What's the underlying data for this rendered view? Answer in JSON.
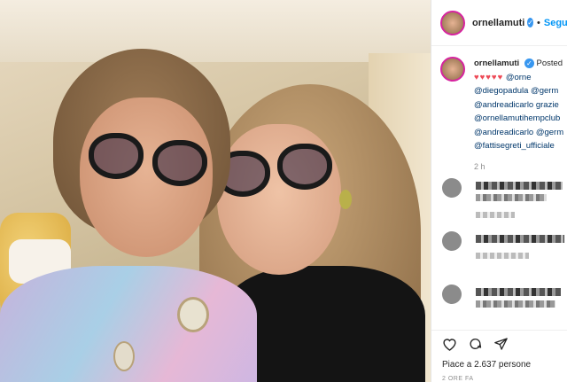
{
  "header": {
    "username": "ornellamuti",
    "separator": "•",
    "follow_label": "Segui"
  },
  "caption": {
    "username": "ornellamuti",
    "posted_label": "Posted",
    "hearts": "♥♥♥♥♥",
    "lines": [
      "@orne",
      "@diegopadula @germ",
      "@andreadicarlo grazie",
      "@ornellamutihempclub",
      "@andreadicarlo @germ",
      "@fattisegreti_ufficiale"
    ],
    "time": "2 h"
  },
  "actions": {
    "like_icon": "heart-icon",
    "comment_icon": "comment-icon",
    "share_icon": "send-icon"
  },
  "likes_text": "Piace a 2.637 persone",
  "ago_text": "2 ORE FA",
  "colors": {
    "follow": "#0095f6",
    "verified": "#3897f0",
    "heart": "#ed4956"
  }
}
